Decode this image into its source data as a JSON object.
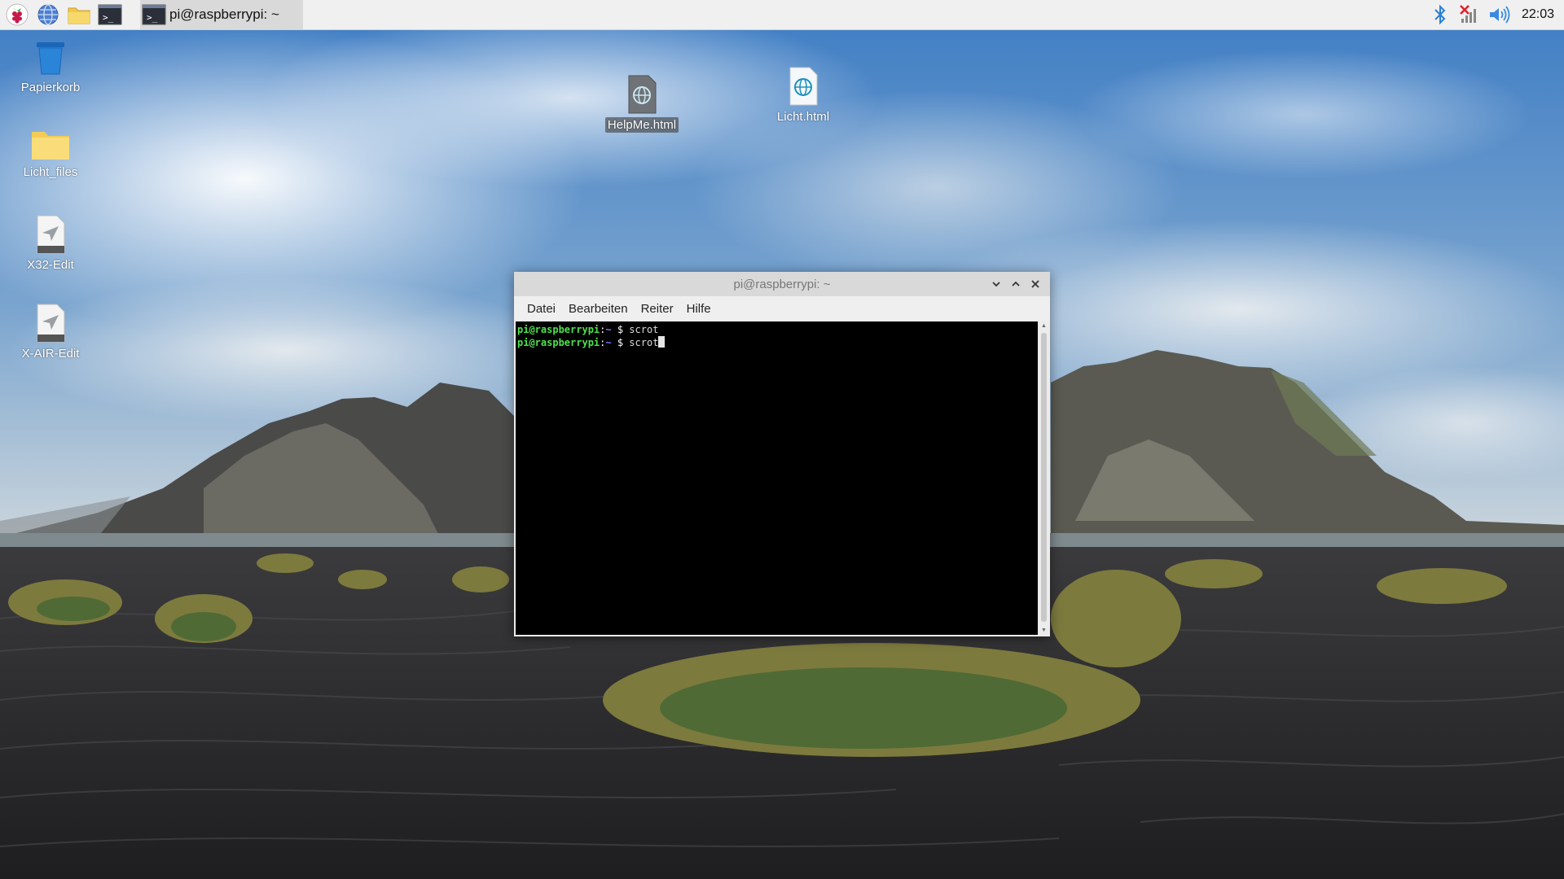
{
  "taskbar": {
    "task_label": "pi@raspberrypi: ~",
    "clock": "22:03",
    "launchers": [
      "raspberry-menu-icon",
      "web-browser-icon",
      "file-manager-icon",
      "terminal-icon"
    ],
    "tray": [
      "bluetooth-icon",
      "network-disconnected-icon",
      "volume-icon"
    ]
  },
  "desktop": {
    "icons": [
      {
        "label": "Papierkorb",
        "icon": "trash-icon"
      },
      {
        "label": "Licht_files",
        "icon": "folder-icon"
      },
      {
        "label": "X32-Edit",
        "icon": "app-icon"
      },
      {
        "label": "X-AIR-Edit",
        "icon": "app-icon"
      },
      {
        "label": "HelpMe.html",
        "icon": "html-file-icon"
      },
      {
        "label": "Licht.html",
        "icon": "html-file-icon"
      }
    ]
  },
  "terminal": {
    "title": "pi@raspberrypi: ~",
    "menu": [
      "Datei",
      "Bearbeiten",
      "Reiter",
      "Hilfe"
    ],
    "prompt_user": "pi@raspberrypi",
    "prompt_sep": ":",
    "prompt_path": "~",
    "prompt_dollar": " $",
    "lines": [
      {
        "command": " scrot"
      },
      {
        "command": " scrot"
      }
    ]
  },
  "colors": {
    "sky_top": "#3a78bf",
    "sand": "#2c2c2e",
    "terminal_bg": "#000000",
    "prompt_user": "#4de24d",
    "prompt_path": "#7a7aff"
  }
}
